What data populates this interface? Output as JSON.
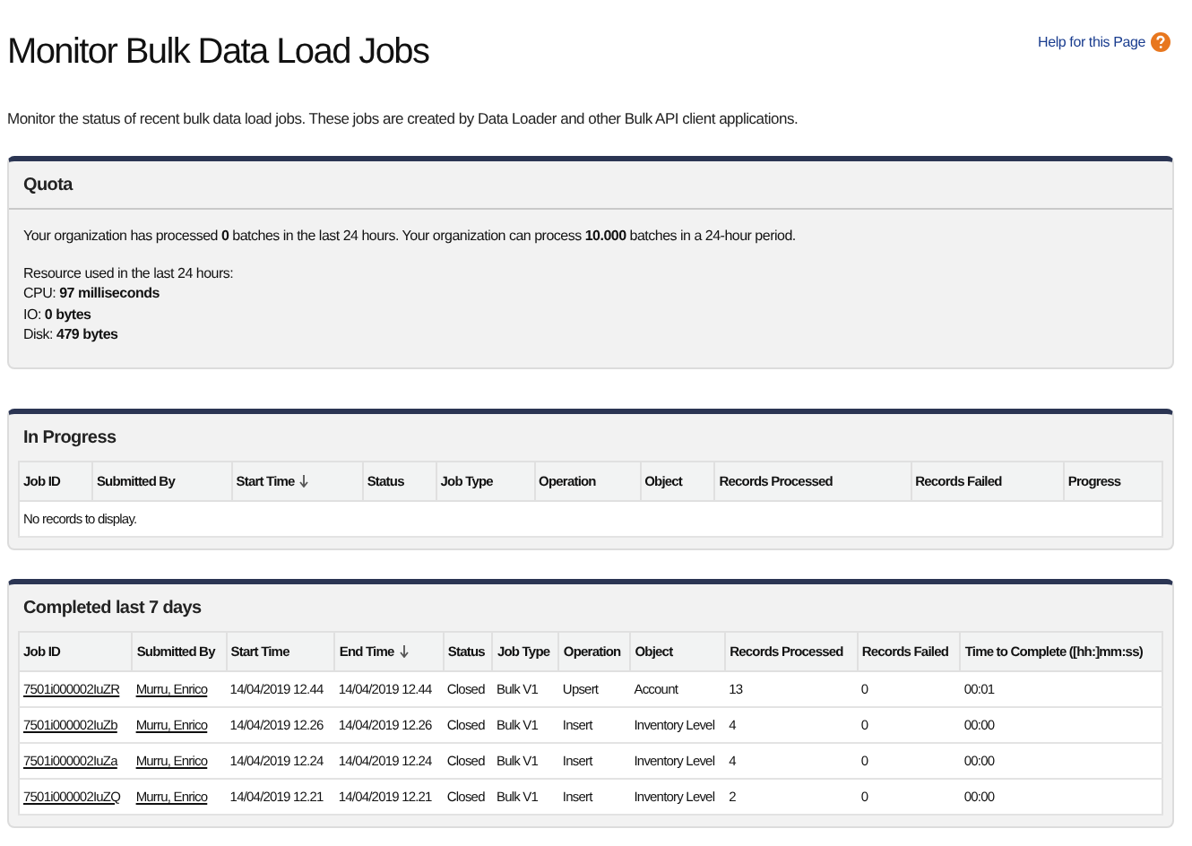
{
  "page": {
    "title": "Monitor Bulk Data Load Jobs",
    "help_link": "Help for this Page",
    "description": "Monitor the status of recent bulk data load jobs. These jobs are created by Data Loader and other Bulk API client applications."
  },
  "quota": {
    "title": "Quota",
    "summary": "Your organization has processed **0** batches in the last 24 hours. Your organization can process **10.000** batches in a 24-hour period.",
    "resource_lines": [
      "Resource used in the last 24 hours:",
      "CPU: **97 milliseconds**",
      "IO: **0 bytes**",
      "Disk: **479 bytes**"
    ]
  },
  "in_progress": {
    "title": "In Progress",
    "columns": [
      {
        "label": "Job ID",
        "sorted": false
      },
      {
        "label": "Submitted By",
        "sorted": false
      },
      {
        "label": "Start Time",
        "sorted": true
      },
      {
        "label": "Status",
        "sorted": false
      },
      {
        "label": "Job Type",
        "sorted": false
      },
      {
        "label": "Operation",
        "sorted": false
      },
      {
        "label": "Object",
        "sorted": false
      },
      {
        "label": "Records Processed",
        "sorted": false
      },
      {
        "label": "Records Failed",
        "sorted": false
      },
      {
        "label": "Progress",
        "sorted": false
      }
    ],
    "empty_message": "No records to display."
  },
  "completed": {
    "title": "Completed last 7 days",
    "columns": [
      {
        "label": "Job ID",
        "sorted": false,
        "link": true
      },
      {
        "label": "Submitted By",
        "sorted": false,
        "link": true
      },
      {
        "label": "Start Time",
        "sorted": false,
        "link": false
      },
      {
        "label": "End Time",
        "sorted": true,
        "link": false
      },
      {
        "label": "Status",
        "sorted": false,
        "link": false
      },
      {
        "label": "Job Type",
        "sorted": false,
        "link": false
      },
      {
        "label": "Operation",
        "sorted": false,
        "link": false
      },
      {
        "label": "Object",
        "sorted": false,
        "link": false
      },
      {
        "label": "Records Processed",
        "sorted": false,
        "link": false
      },
      {
        "label": "Records Failed",
        "sorted": false,
        "link": false
      },
      {
        "label": "Time to Complete ([hh:]mm:ss)",
        "sorted": false,
        "link": false
      }
    ],
    "rows": [
      [
        "7501i000002IuZR",
        "Murru, Enrico",
        "14/04/2019 12.44",
        "14/04/2019 12.44",
        "Closed",
        "Bulk V1",
        "Upsert",
        "Account",
        "13",
        "0",
        "00:01"
      ],
      [
        "7501i000002IuZb",
        "Murru, Enrico",
        "14/04/2019 12.26",
        "14/04/2019 12.26",
        "Closed",
        "Bulk V1",
        "Insert",
        "Inventory Level",
        "4",
        "0",
        "00:00"
      ],
      [
        "7501i000002IuZa",
        "Murru, Enrico",
        "14/04/2019 12.24",
        "14/04/2019 12.24",
        "Closed",
        "Bulk V1",
        "Insert",
        "Inventory Level",
        "4",
        "0",
        "00:00"
      ],
      [
        "7501i000002IuZQ",
        "Murru, Enrico",
        "14/04/2019 12.21",
        "14/04/2019 12.21",
        "Closed",
        "Bulk V1",
        "Insert",
        "Inventory Level",
        "2",
        "0",
        "00:00"
      ]
    ]
  }
}
